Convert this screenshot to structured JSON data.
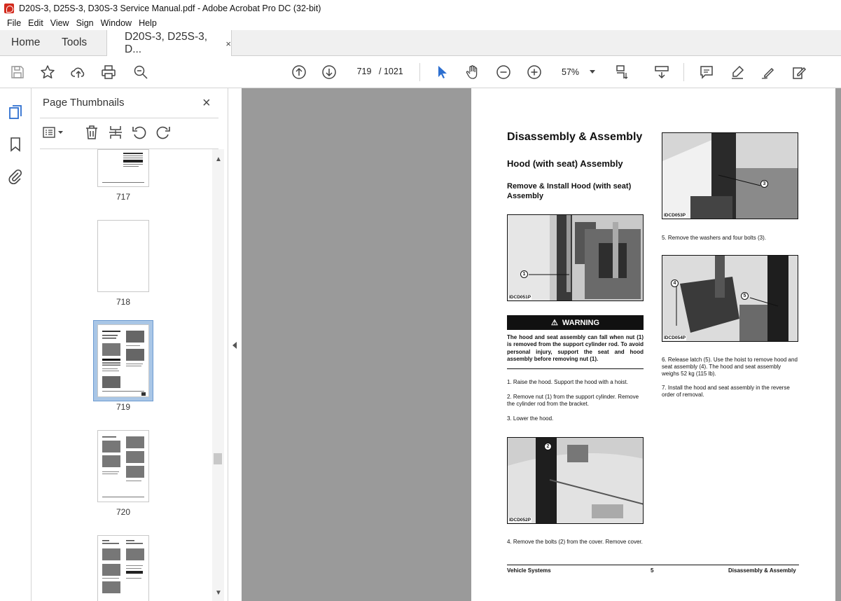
{
  "window": {
    "title": "D20S-3, D25S-3, D30S-3 Service Manual.pdf - Adobe Acrobat Pro DC (32-bit)"
  },
  "menu": [
    "File",
    "Edit",
    "View",
    "Sign",
    "Window",
    "Help"
  ],
  "tabs": {
    "home": "Home",
    "tools": "Tools",
    "document": "D20S-3, D25S-3, D...",
    "close": "×"
  },
  "toolbar": {
    "current_page": "719",
    "total_pages": "/ 1021",
    "zoom": "57%",
    "icons": [
      "save-icon",
      "bookmark-star-icon",
      "upload-icon",
      "print-icon",
      "zoom-search-icon",
      "page-up-icon",
      "page-down-icon",
      "select-cursor-icon",
      "hand-tool-icon",
      "zoom-out-icon",
      "zoom-in-icon",
      "page-fit-icon",
      "scroll-mode-icon",
      "comment-icon",
      "highlight-icon",
      "draw-icon",
      "fill-sign-icon"
    ]
  },
  "thumbnails_panel": {
    "title": "Page Thumbnails",
    "close": "×",
    "pages": [
      {
        "label": "717",
        "selected": false
      },
      {
        "label": "718",
        "selected": false
      },
      {
        "label": "719",
        "selected": true
      },
      {
        "label": "720",
        "selected": false
      },
      {
        "label": "",
        "selected": false
      }
    ]
  },
  "document": {
    "heading": "Disassembly & Assembly",
    "subheading": "Hood (with seat) Assembly",
    "section_title": "Remove & Install Hood (with seat) Assembly",
    "photos": {
      "p1": {
        "id": "IDCD051P",
        "callout": "1"
      },
      "p2": {
        "id": "IDCD052P",
        "callout": "2"
      },
      "p3": {
        "id": "IDCD053P",
        "callout": "3"
      },
      "p4": {
        "id": "IDCD054P",
        "callouts": [
          "4",
          "5"
        ]
      }
    },
    "warning_label": "WARNING",
    "warning_text": "The hood and seat assembly can fall when nut (1) is removed from the support cylinder rod. To avoid personal injury, support the seat and hood assembly before removing nut (1).",
    "steps": {
      "s1": "1. Raise the hood. Support the hood with a hoist.",
      "s2": "2. Remove nut (1) from the support cylinder. Remove the cylinder rod from the bracket.",
      "s3": "3. Lower the hood.",
      "s4": "4. Remove the bolts (2) from the cover. Remove cover.",
      "s5": "5. Remove the washers and four bolts (3).",
      "s6": "6. Release latch (5). Use the hoist to remove hood and seat assembly (4). The hood and seat assembly weighs 52 kg (115 lb).",
      "s7": "7. Install the hood and seat assembly in the reverse order of removal."
    },
    "footer": {
      "left": "Vehicle Systems",
      "middle": "5",
      "right": "Disassembly & Assembly"
    }
  },
  "colors": {
    "accent_blue": "#2d6fd0",
    "viewport_bg": "#9a9a9a",
    "selection": "#a9c6e6",
    "app_red": "#d32b1e"
  }
}
